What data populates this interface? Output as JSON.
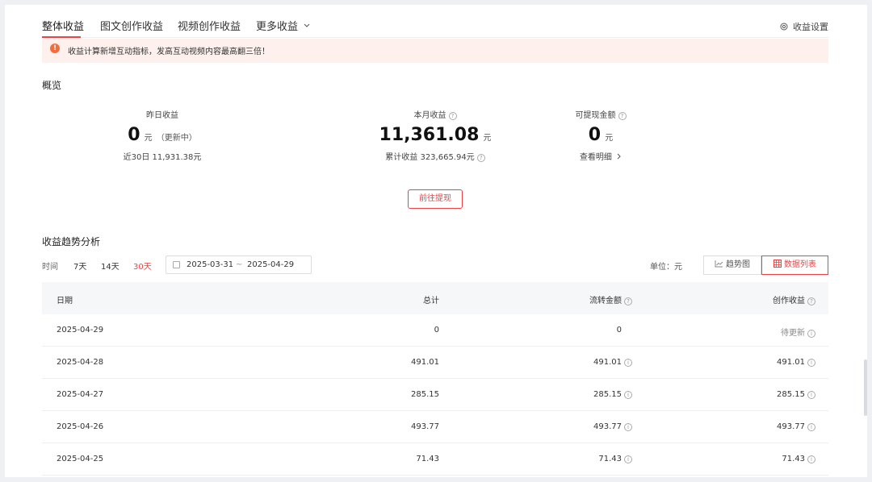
{
  "tabs": [
    {
      "label": "整体收益",
      "active": true
    },
    {
      "label": "图文创作收益",
      "active": false
    },
    {
      "label": "视频创作收益",
      "active": false
    },
    {
      "label": "更多收益",
      "active": false
    }
  ],
  "settings_label": "收益设置",
  "notice": "收益计算新增互动指标，发高互动视频内容最高翻三倍！",
  "overview": {
    "title": "概览",
    "yesterday": {
      "label": "昨日收益",
      "value": "0",
      "unit": "元",
      "note": "（更新中）",
      "sub": "近30日 11,931.38元"
    },
    "month": {
      "label": "本月收益",
      "value": "11,361.08",
      "unit": "元",
      "sub": "累计收益 323,665.94元"
    },
    "withdrawable": {
      "label": "可提现金额",
      "value": "0",
      "unit": "元",
      "sub": "查看明细"
    },
    "withdraw_button": "前往提现"
  },
  "trend": {
    "title": "收益趋势分析",
    "time_label": "时间",
    "ranges": [
      "7天",
      "14天",
      "30天"
    ],
    "selected_range": "30天",
    "date_start": "2025-03-31",
    "date_sep": "~",
    "date_end": "2025-04-29",
    "unit_label": "单位：元",
    "view_chart": "趋势图",
    "view_table": "数据列表"
  },
  "table": {
    "headers": {
      "date": "日期",
      "total": "总计",
      "flow": "流转金额",
      "creation": "创作收益"
    },
    "rows": [
      {
        "date": "2025-04-29",
        "total": "0",
        "flow": "0",
        "creation": "待更新"
      },
      {
        "date": "2025-04-28",
        "total": "491.01",
        "flow": "491.01",
        "creation": "491.01"
      },
      {
        "date": "2025-04-27",
        "total": "285.15",
        "flow": "285.15",
        "creation": "285.15"
      },
      {
        "date": "2025-04-26",
        "total": "493.77",
        "flow": "493.77",
        "creation": "493.77"
      },
      {
        "date": "2025-04-25",
        "total": "71.43",
        "flow": "71.43",
        "creation": "71.43"
      }
    ]
  },
  "colors": {
    "accent": "#f04142",
    "notice_bg": "#fdf0ed",
    "warn": "#f26d3d"
  },
  "icons": {
    "settings": "settings-icon",
    "warning": "warning-icon",
    "calendar": "calendar-icon",
    "chart": "line-chart-icon",
    "grid": "table-icon"
  }
}
